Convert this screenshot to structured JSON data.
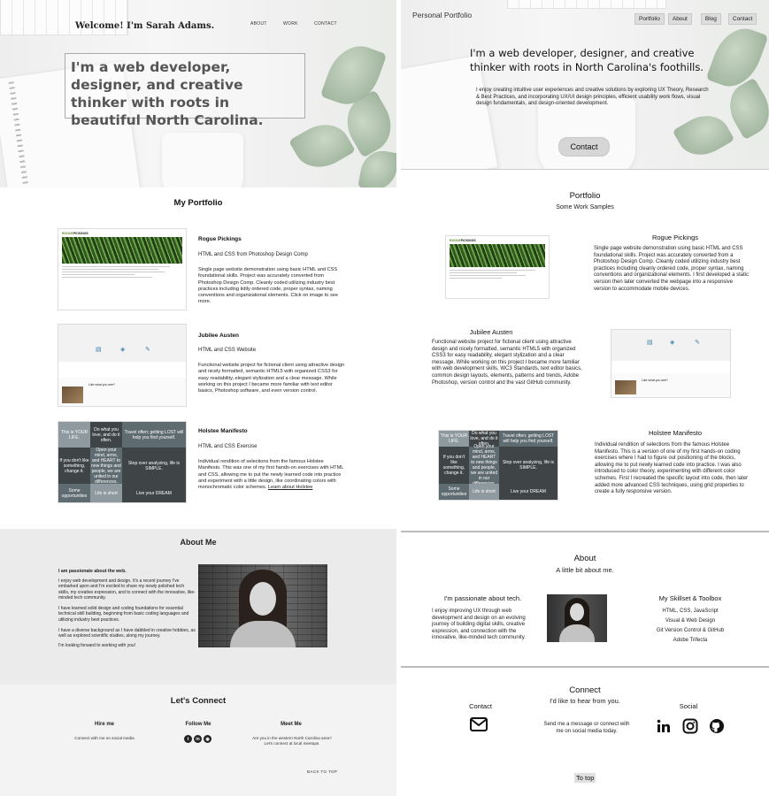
{
  "left": {
    "brand": "Welcome! I'm Sarah Adams.",
    "nav": [
      "ABOUT",
      "WORK",
      "CONTACT"
    ],
    "hero_text": "I'm a web developer, designer, and creative thinker with roots in beautiful North Carolina.",
    "portfolio_title": "My Portfolio",
    "projects": [
      {
        "title": "Rogue Pickings",
        "subtitle": "HTML and CSS from Photoshop Design Comp",
        "desc": "Single page website demonstration using basic HTML and CSS foundational skills. Project was accurately converted from Photoshop Design Comp. Cleanly coded utilizing industry best practices including tidily ordered code, proper syntax, naming conventions and organizational elements. Click on image to see more."
      },
      {
        "title": "Jubilee Austen",
        "subtitle": "HTML and CSS Website",
        "desc": "Functional website project for fictional client using attractive design and nicely formatted, semantic HTML5 with organized CSS3 for easy readability, elegant stylization and a clear message. While working on this project I became more familiar with text editor basics, Photoshop software, and even version control."
      },
      {
        "title": "Holstee Manifesto",
        "subtitle": "HTML and CSS Exercise",
        "desc": "Individual rendition of selections from the famous Holstee Manifesto. This was one of my first hands-on exercises with HTML and CSS, allowing me to put the newly learned code into practice and experiment with a little design, like coordinating colors with monochromatic color schemes.",
        "link": "Learn about Holstee"
      }
    ],
    "about": {
      "title": "About Me",
      "lead": "I am passionate about the web.",
      "paragraphs": [
        "I enjoy web development and design. It's a recent journey I've embarked upon and I'm excited to share my newly polished tech skills, my creative expression, and to connect with the innovative, like-minded tech community.",
        "I have learned solid design and coding foundations for essential technical skill building, beginning from basic coding languages and utilizing industry best practices.",
        "I have a diverse background as I have dabbled in creative hobbies, as well as explored scientific studies, along my journey.",
        "I'm looking forward to working with you!"
      ]
    },
    "connect": {
      "title": "Let's Connect",
      "cols": [
        {
          "heading": "Hire me",
          "text": "Connect with me on social media"
        },
        {
          "heading": "Follow Me",
          "text": ""
        },
        {
          "heading": "Meet Me",
          "text": "Are you in the western North Carolina area? Let's connect at local meetups."
        }
      ],
      "back_to_top": "BACK TO TOP"
    }
  },
  "right": {
    "brand": "Personal Portfolio",
    "nav": [
      "Portfolio",
      "About",
      "Blog",
      "Contact"
    ],
    "hero_title": "I'm a web developer, designer, and creative thinker with roots in North Carolina's foothills.",
    "hero_text": "I enjoy creating intuitive user experiences and creative solutions by exploring UX Theory, Research & Best Practices, and incorporating UX/UI design principles, efficient usability work flows, visual design fundamentals, and design-oriented development.",
    "contact_button": "Contact",
    "portfolio_title": "Portfolio",
    "portfolio_sub": "Some Work Samples",
    "projects": [
      {
        "title": "Rogue Pickings",
        "desc": "Single page website demonstration using basic HTML and CSS foundational skills. Project was accurately converted from a Photoshop Design Comp. Cleanly coded utilizing industry best practices including cleanly ordered code, proper syntax, naming conventions and organizational elements. I first developed a static version then later converted the webpage into a responsive version to accommodate mobile devices."
      },
      {
        "title": "Jubilee Austen",
        "desc": "Functional website project for fictional client using attractive design and nicely formatted, semantic HTML5 with organized CSS3 for easy readability, elegant stylization and a clear message. While working on this project I became more familiar with web development skills, WC3 Standards, text editor basics, common design layouts, elements, patterns and trends, Adobe Photoshop, version control and the vast GitHub community."
      },
      {
        "title": "Holstee Manifesto",
        "desc": "Individual rendition of selections from the famous Holstee Manifesto. This is a version of one of my first hands-on coding exercises where I had to figure out positioning of the blocks, allowing me to put newly learned code into practice. I was also introduced to color theory, experimenting with different color schemes. First I recreated the specific layout into code, then later added more advanced CSS techniques, using grid properties to create a fully responsive version."
      }
    ],
    "about": {
      "title": "About",
      "sub": "A little bit about me.",
      "lead": "I'm passionate about tech.",
      "text": "I enjoy improving UX through web development and design on an evolving journey of building digital skills, creative expression, and connection with the innovative, like-minded tech community.",
      "skills_title": "My Skillset & Toolbox",
      "skills": [
        "HTML, CSS, JavaScript",
        "Visual & Web Design",
        "Git Version Control & GitHub",
        "Adobe Trifecta"
      ]
    },
    "connect": {
      "title": "Connect",
      "sub": "I'd like to hear from you.",
      "contact_heading": "Contact",
      "contact_text": "Send me a message or connect with me on social media today.",
      "social_heading": "Social",
      "to_top": "To top"
    }
  },
  "thumbs": {
    "rogue_brand_1": "ROGUE",
    "rogue_brand_2": " PICKINGS",
    "holstee_cells": [
      "This is YOUR LIFE.",
      "Do what you love, and do it often.",
      "Travel often; getting LOST will help you find yourself.",
      "If you don't like something, change it.",
      "Open your mind, arms, and HEART to new things and people, we are united in our differences.",
      "Stop over analyzing, life is SIMPLE.",
      "Some opportunities",
      "Life is short",
      "Live your DREAM"
    ],
    "jubilee_caption": "Like what you see?"
  },
  "colors": {
    "holstee_dark": "#3f4447",
    "holstee_mid": "#5e6b70",
    "holstee_light": "#8e9aa0",
    "about_bg": "#ebebeb"
  }
}
